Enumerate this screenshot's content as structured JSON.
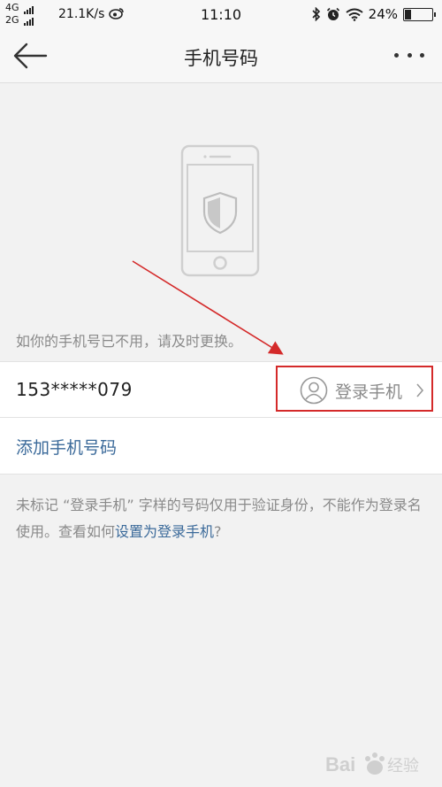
{
  "status_bar": {
    "net_top": "4G",
    "net_bottom": "2G",
    "speed": "21.1K/s",
    "time": "11:10",
    "battery": "24%",
    "battery_level": 0.24
  },
  "nav": {
    "title": "手机号码"
  },
  "hint": "如你的手机号已不用，请及时更换。",
  "phone_row": {
    "number": "153*****079",
    "badge_label": "登录手机"
  },
  "add_phone": "添加手机号码",
  "note": {
    "text": "未标记 “登录手机” 字样的号码仅用于验证身份，不能作为登录名使用。查看如何",
    "link": "设置为登录手机",
    "suffix": "?"
  },
  "watermark": "Bai 经验",
  "colors": {
    "accent_link": "#3b6a9a",
    "annotation_red": "#d42a2a"
  }
}
